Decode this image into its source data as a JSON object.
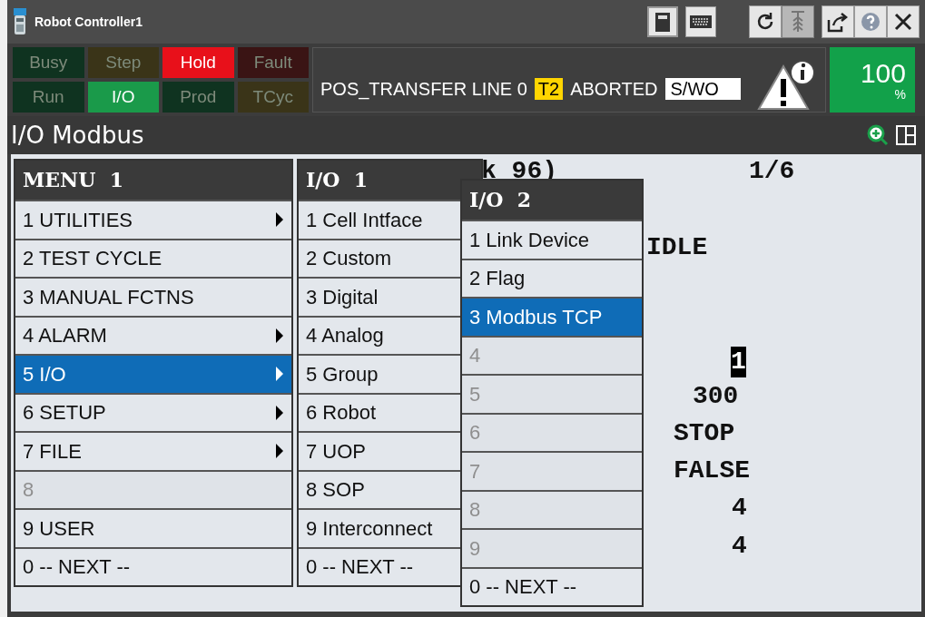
{
  "window": {
    "title": "Robot Controller1"
  },
  "status_lamps": [
    {
      "label": "Busy",
      "on": false,
      "color": "#0f3320"
    },
    {
      "label": "Step",
      "on": false,
      "color": "#3a3418"
    },
    {
      "label": "Hold",
      "on": true,
      "color": "#e8101a"
    },
    {
      "label": "Fault",
      "on": false,
      "color": "#3a1414"
    },
    {
      "label": "Run",
      "on": false,
      "color": "#0f3320"
    },
    {
      "label": "I/O",
      "on": true,
      "color": "#1a9a4a"
    },
    {
      "label": "Prod",
      "on": false,
      "color": "#0f3320"
    },
    {
      "label": "TCyc",
      "on": false,
      "color": "#3a3418"
    }
  ],
  "status_line": {
    "program": "POS_TRANSFER LINE 0",
    "mode": "T2",
    "state": "ABORTED",
    "flag": "S/WO"
  },
  "override": {
    "value": "100",
    "unit": "%"
  },
  "screen": {
    "title": "I/O Modbus",
    "background_text": [
      "k 96)",
      "1/6",
      "IDLE",
      "1",
      "300",
      "STOP",
      "FALSE",
      "4",
      "4"
    ]
  },
  "menus": [
    {
      "title": "MENU  1",
      "items": [
        {
          "label": "1 UTILITIES",
          "submenu": true,
          "selected": false,
          "disabled": false
        },
        {
          "label": "2 TEST CYCLE",
          "submenu": false,
          "selected": false,
          "disabled": false
        },
        {
          "label": "3 MANUAL FCTNS",
          "submenu": false,
          "selected": false,
          "disabled": false
        },
        {
          "label": "4 ALARM",
          "submenu": true,
          "selected": false,
          "disabled": false
        },
        {
          "label": "5 I/O",
          "submenu": true,
          "selected": true,
          "disabled": false
        },
        {
          "label": "6 SETUP",
          "submenu": true,
          "selected": false,
          "disabled": false
        },
        {
          "label": "7 FILE",
          "submenu": true,
          "selected": false,
          "disabled": false
        },
        {
          "label": "8",
          "submenu": false,
          "selected": false,
          "disabled": true
        },
        {
          "label": "9 USER",
          "submenu": false,
          "selected": false,
          "disabled": false
        },
        {
          "label": "0 -- NEXT --",
          "submenu": false,
          "selected": false,
          "disabled": false
        }
      ]
    },
    {
      "title": "I/O  1",
      "items": [
        {
          "label": "1 Cell Intface",
          "selected": false,
          "disabled": false
        },
        {
          "label": "2 Custom",
          "selected": false,
          "disabled": false
        },
        {
          "label": "3 Digital",
          "selected": false,
          "disabled": false
        },
        {
          "label": "4 Analog",
          "selected": false,
          "disabled": false
        },
        {
          "label": "5 Group",
          "selected": false,
          "disabled": false
        },
        {
          "label": "6 Robot",
          "selected": false,
          "disabled": false
        },
        {
          "label": "7 UOP",
          "selected": false,
          "disabled": false
        },
        {
          "label": "8 SOP",
          "selected": false,
          "disabled": false
        },
        {
          "label": "9 Interconnect",
          "selected": false,
          "disabled": false
        },
        {
          "label": "0 -- NEXT --",
          "selected": false,
          "disabled": false
        }
      ]
    },
    {
      "title": "I/O  2",
      "items": [
        {
          "label": "1 Link Device",
          "selected": false,
          "disabled": false
        },
        {
          "label": "2 Flag",
          "selected": false,
          "disabled": false
        },
        {
          "label": "3 Modbus TCP",
          "selected": true,
          "disabled": false
        },
        {
          "label": "4",
          "selected": false,
          "disabled": true
        },
        {
          "label": "5",
          "selected": false,
          "disabled": true
        },
        {
          "label": "6",
          "selected": false,
          "disabled": true
        },
        {
          "label": "7",
          "selected": false,
          "disabled": true
        },
        {
          "label": "8",
          "selected": false,
          "disabled": true
        },
        {
          "label": "9",
          "selected": false,
          "disabled": true
        },
        {
          "label": "0 -- NEXT --",
          "selected": false,
          "disabled": false
        }
      ]
    }
  ]
}
